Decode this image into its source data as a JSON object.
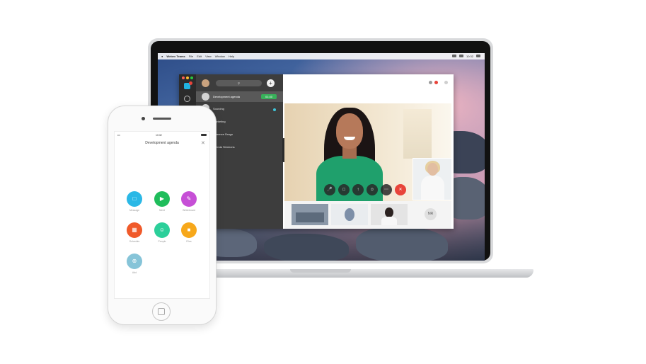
{
  "mac": {
    "menubar": [
      "Webex Teams",
      "File",
      "Edit",
      "View",
      "Window",
      "Help"
    ],
    "clock": "10:32"
  },
  "teams_app": {
    "search_icon_name": "search-icon",
    "spaces": [
      {
        "label": "Development agenda",
        "active": true,
        "badge": "01:40"
      },
      {
        "label": "Sourcing",
        "active": false,
        "unread": true
      },
      {
        "label": "Marketing",
        "active": false
      },
      {
        "label": "Clarence Drago",
        "active": false
      },
      {
        "label": "Brenda Simmons",
        "active": false
      }
    ],
    "call_controls": [
      "mute",
      "video",
      "share",
      "participants",
      "more",
      "end"
    ],
    "participant_initials": "MR",
    "colors": {
      "end_call": "#e8443a",
      "badge": "#38b15a",
      "sidebar": "#3d3d3d"
    }
  },
  "phone": {
    "time": "10:32",
    "title": "Development agenda",
    "actions": [
      {
        "label": "Message",
        "color": "#2bb8e6",
        "icon": "message-icon"
      },
      {
        "label": "Meet",
        "color": "#1fbd5b",
        "icon": "meet-icon"
      },
      {
        "label": "Whiteboard",
        "color": "#c64fd6",
        "icon": "whiteboard-icon"
      },
      {
        "label": "Schedule",
        "color": "#f05a2a",
        "icon": "schedule-icon"
      },
      {
        "label": "People",
        "color": "#2ccf9a",
        "icon": "people-icon"
      },
      {
        "label": "Files",
        "color": "#f7a81b",
        "icon": "files-icon"
      },
      {
        "label": "Add",
        "color": "#86c4d8",
        "icon": "add-icon"
      }
    ]
  }
}
